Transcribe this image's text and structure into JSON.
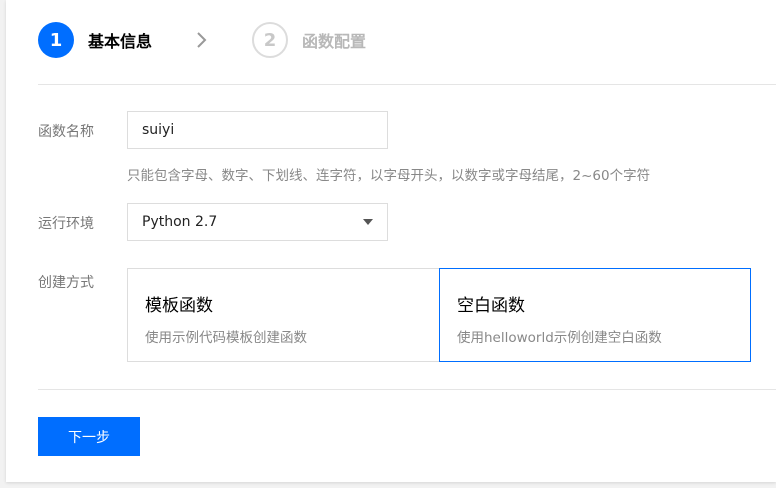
{
  "steps": [
    {
      "number": "1",
      "label": "基本信息",
      "state": "active"
    },
    {
      "number": "2",
      "label": "函数配置",
      "state": "inactive"
    }
  ],
  "form": {
    "name": {
      "label": "函数名称",
      "value": "suiyi",
      "hint": "只能包含字母、数字、下划线、连字符，以字母开头，以数字或字母结尾，2~60个字符"
    },
    "runtime": {
      "label": "运行环境",
      "selected": "Python 2.7"
    },
    "create_method": {
      "label": "创建方式",
      "options": [
        {
          "title": "模板函数",
          "desc": "使用示例代码模板创建函数",
          "selected": false
        },
        {
          "title": "空白函数",
          "desc": "使用helloworld示例创建空白函数",
          "selected": true
        }
      ]
    }
  },
  "actions": {
    "next_label": "下一步"
  },
  "colors": {
    "accent": "#006eff",
    "border": "#dddddd",
    "muted_text": "#888888"
  }
}
